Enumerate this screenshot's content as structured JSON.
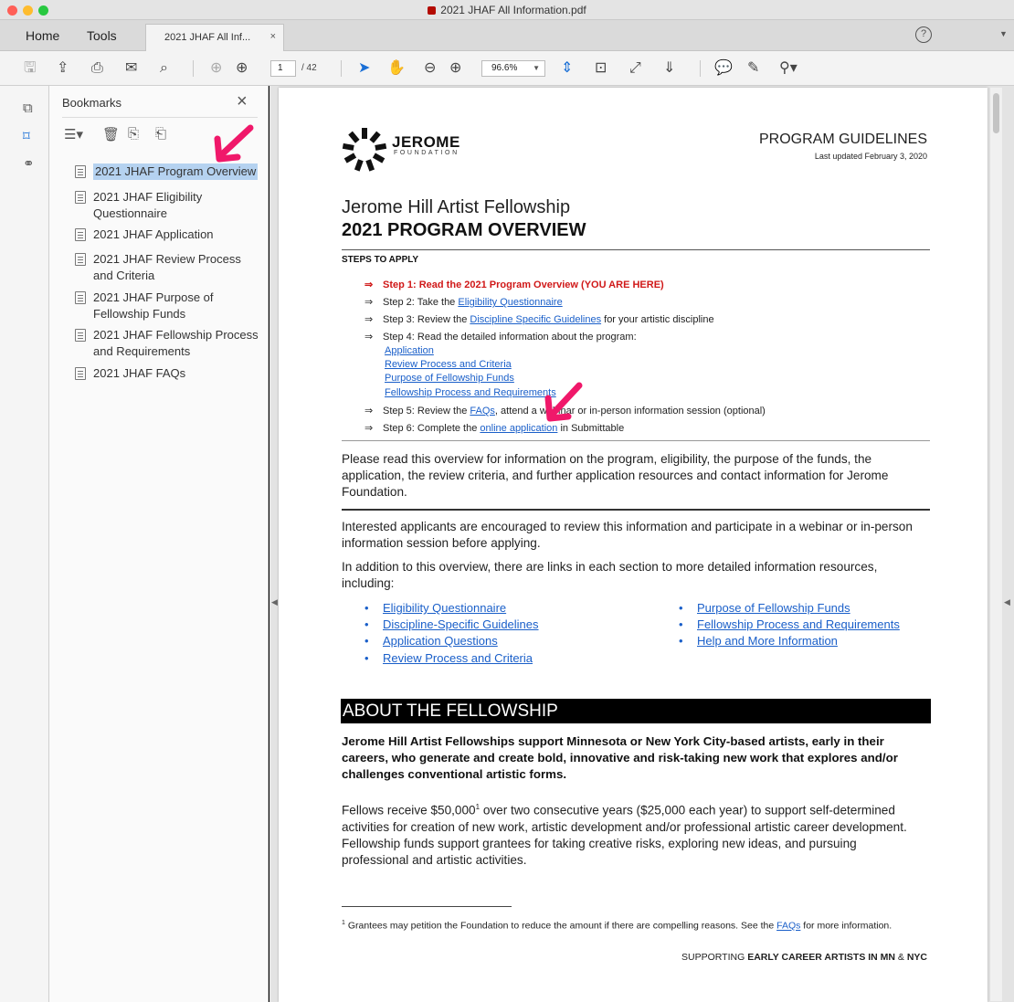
{
  "window": {
    "title": "2021 JHAF All Information.pdf"
  },
  "tabs": {
    "home": "Home",
    "tools": "Tools",
    "doc_tab": "2021 JHAF All Inf...",
    "close": "×"
  },
  "toolbar": {
    "page_current": "1",
    "page_total": "/ 42",
    "zoom": "96.6%"
  },
  "bookmarks": {
    "title": "Bookmarks",
    "close": "×",
    "items": [
      {
        "label": "2021 JHAF Program Overview",
        "selected": true
      },
      {
        "label": "2021 JHAF Eligibility Questionnaire"
      },
      {
        "label": "2021 JHAF Application"
      },
      {
        "label": "2021 JHAF Review Process and Criteria"
      },
      {
        "label": "2021 JHAF Purpose of Fellowship Funds"
      },
      {
        "label": "2021 JHAF Fellowship Process and Requirements"
      },
      {
        "label": "2021 JHAF FAQs"
      }
    ]
  },
  "doc": {
    "logo_name": "JEROME",
    "logo_sub": "FOUNDATION",
    "program_label": "PROGRAM GUIDELINES",
    "updated": "Last updated February 3, 2020",
    "subtitle": "Jerome Hill Artist Fellowship",
    "title": "2021 PROGRAM OVERVIEW",
    "steps_heading": "STEPS TO APPLY",
    "step1": "Step 1: Read the 2021 Program Overview (YOU ARE HERE)",
    "step2_pre": "Step 2: Take the ",
    "step2_link": "Eligibility Questionnaire",
    "step3_pre": "Step 3: Review the ",
    "step3_link": "Discipline Specific Guidelines",
    "step3_post": " for your artistic discipline",
    "step4": "Step 4: Read the detailed information about the program:",
    "step4_links": [
      "Application",
      "Review Process and Criteria",
      "Purpose of Fellowship Funds",
      "Fellowship Process and Requirements"
    ],
    "step5_pre": "Step 5: Review the ",
    "step5_link": "FAQs",
    "step5_post": ", attend a webinar or in-person information session (optional)",
    "step6_pre": "Step 6: Complete the ",
    "step6_link": "online application",
    "step6_post": " in Submittable",
    "intro": "Please read this overview for information on the program, eligibility, the purpose of the funds, the application, the review criteria, and further application resources and contact information for Jerome Foundation.",
    "para1": "Interested applicants are encouraged to review this information and participate in a webinar or in-person information session before applying.",
    "para2": "In addition to this overview, there are links in each section to more detailed information resources, including:",
    "bullets_left": [
      "Eligibility Questionnaire",
      "Discipline-Specific Guidelines",
      "Application Questions",
      "Review Process and Criteria"
    ],
    "bullets_right": [
      "Purpose of Fellowship Funds",
      "Fellowship Process and Requirements",
      "Help and More Information"
    ],
    "about_heading": "ABOUT THE FELLOWSHIP",
    "about_bold": "Jerome Hill Artist Fellowships support Minnesota or New York City-based artists, early in their careers, who generate and create bold, innovative and risk-taking new work that explores and/or challenges conventional artistic forms.",
    "about_body_pre": "Fellows receive $50,000",
    "about_body_sup": "1",
    "about_body_post": " over two consecutive years ($25,000 each year) to support self-determined activities for creation of new work, artistic development and/or professional artistic career development. Fellowship funds support grantees for taking creative risks, exploring new ideas, and pursuing professional and artistic activities.",
    "footnote_sup": "1",
    "footnote_pre": " Grantees may petition the Foundation to reduce the amount if there are compelling reasons. See the ",
    "footnote_link": "FAQs",
    "footnote_post": " for more information.",
    "tag_pre": "SUPPORTING ",
    "tag_bold": "EARLY CAREER ARTISTS IN MN",
    "tag_mid": " & ",
    "tag_bold2": "NYC"
  },
  "colors": {
    "annotation_arrow": "#f0186a",
    "link": "#1a5fc9",
    "step1_red": "#d01818",
    "selection": "#b5d2f0"
  }
}
